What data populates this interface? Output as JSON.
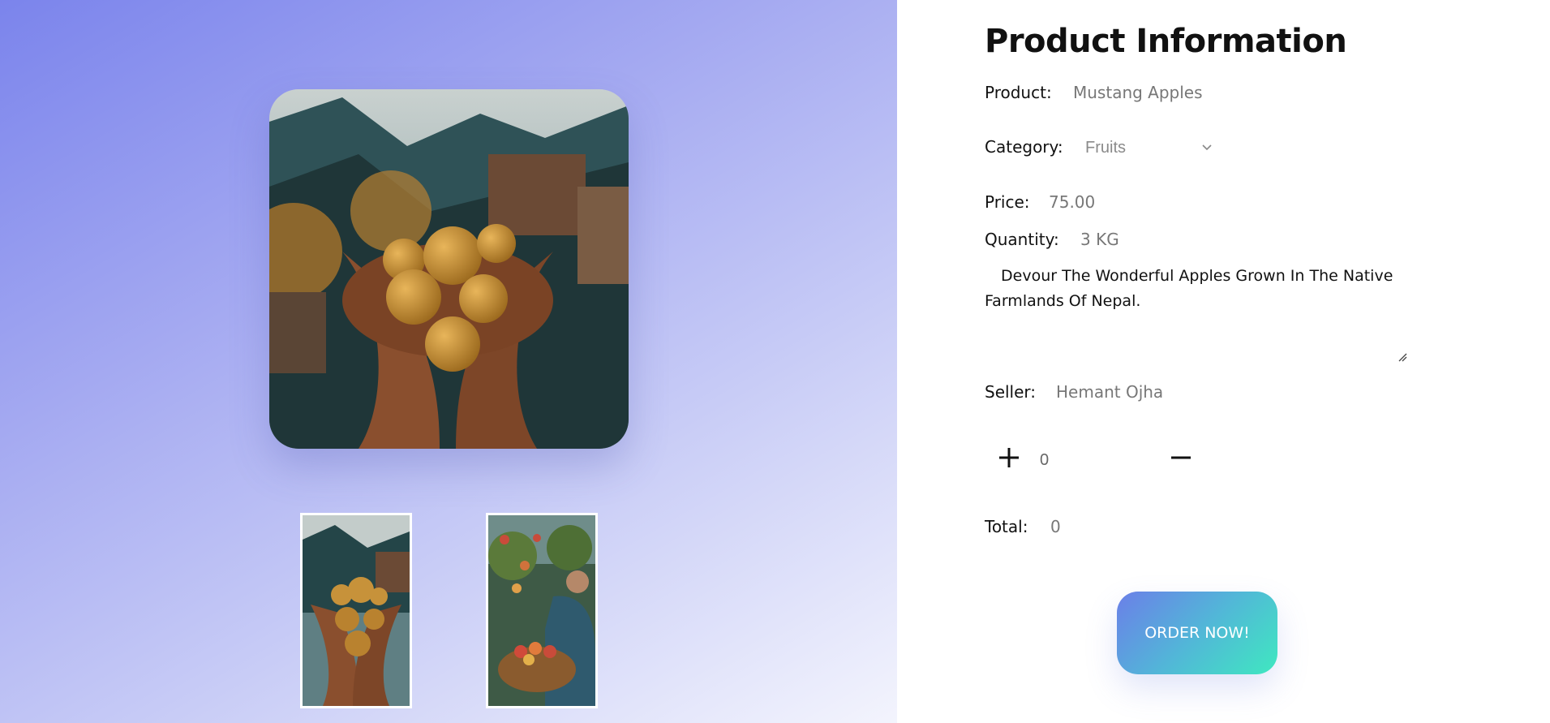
{
  "product_info": {
    "title": "Product Information",
    "product_label": "Product:",
    "product_value": "Mustang Apples",
    "category_label": "Category:",
    "category_selected": "Fruits",
    "price_label": "Price:",
    "price_value": "75.00",
    "quantity_label": "Quantity:",
    "quantity_value": "3 KG",
    "description": "Devour The Wonderful Apples Grown In The Native Farmlands Of Nepal.",
    "seller_label": "Seller:",
    "seller_value": "Hemant Ojha"
  },
  "order": {
    "quantity_input": "0",
    "total_label": "Total:",
    "total_value": "0",
    "order_button": "ORDER NOW!"
  },
  "icons": {
    "increase": "plus-icon",
    "decrease": "minus-icon",
    "dropdown": "chevron-down-icon",
    "resize": "resize-grip-icon"
  },
  "colors": {
    "gradient_start": "#7b84ec",
    "gradient_end": "#f3f4fd",
    "button_start": "#6b7fe8",
    "button_end": "#3fe8c0"
  }
}
